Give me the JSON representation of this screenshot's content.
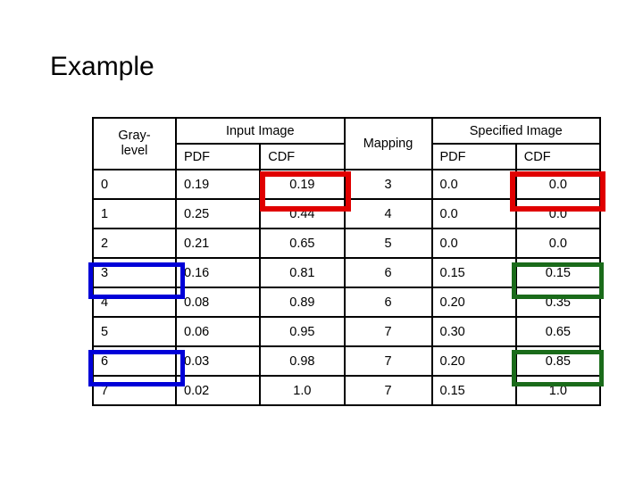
{
  "slide": {
    "title": "Example",
    "background_color": "#ffffff"
  },
  "table": {
    "headers": {
      "gray_level": "Gray-\nlevel",
      "gray_level_line1": "Gray-",
      "gray_level_line2": "level",
      "input_image": "Input Image",
      "mapping": "Mapping",
      "specified_image": "Specified Image",
      "input_pdf": "PDF",
      "input_cdf": "CDF",
      "specified_pdf": "PDF",
      "specified_cdf": "CDF"
    },
    "rows": [
      {
        "gray_level": "0",
        "input_pdf": "0.19",
        "input_cdf": "0.19",
        "mapping": "3",
        "specified_pdf": "0.0",
        "specified_cdf": "0.0"
      },
      {
        "gray_level": "1",
        "input_pdf": "0.25",
        "input_cdf": "0.44",
        "mapping": "4",
        "specified_pdf": "0.0",
        "specified_cdf": "0.0"
      },
      {
        "gray_level": "2",
        "input_pdf": "0.21",
        "input_cdf": "0.65",
        "mapping": "5",
        "specified_pdf": "0.0",
        "specified_cdf": "0.0"
      },
      {
        "gray_level": "3",
        "input_pdf": "0.16",
        "input_cdf": "0.81",
        "mapping": "6",
        "specified_pdf": "0.15",
        "specified_cdf": "0.15"
      },
      {
        "gray_level": "4",
        "input_pdf": "0.08",
        "input_cdf": "0.89",
        "mapping": "6",
        "specified_pdf": "0.20",
        "specified_cdf": "0.35"
      },
      {
        "gray_level": "5",
        "input_pdf": "0.06",
        "input_cdf": "0.95",
        "mapping": "7",
        "specified_pdf": "0.30",
        "specified_cdf": "0.65"
      },
      {
        "gray_level": "6",
        "input_pdf": "0.03",
        "input_cdf": "0.98",
        "mapping": "7",
        "specified_pdf": "0.20",
        "specified_cdf": "0.85"
      },
      {
        "gray_level": "7",
        "input_pdf": "0.02",
        "input_cdf": "1.0",
        "mapping": "7",
        "specified_pdf": "0.15",
        "specified_cdf": "1.0"
      }
    ]
  },
  "highlights": {
    "cyan_fill": "#00b0f0",
    "yellow_fill": "#ffff00",
    "red_outline": "#e00000",
    "blue_outline": "#0000d8",
    "green_outline": "#1a6b1a",
    "cyan_cells": [
      "gray_level row 3",
      "gray_level row 6"
    ],
    "yellow_cells": [
      "specified_cdf row 3",
      "specified_cdf row 6"
    ],
    "red_boxes": [
      "input_cdf row 0",
      "specified_cdf row 0"
    ],
    "green_boxes": [
      "specified_cdf row 3",
      "specified_cdf row 6"
    ],
    "blue_boxes": [
      "gray_level row 3",
      "gray_level row 6"
    ]
  }
}
